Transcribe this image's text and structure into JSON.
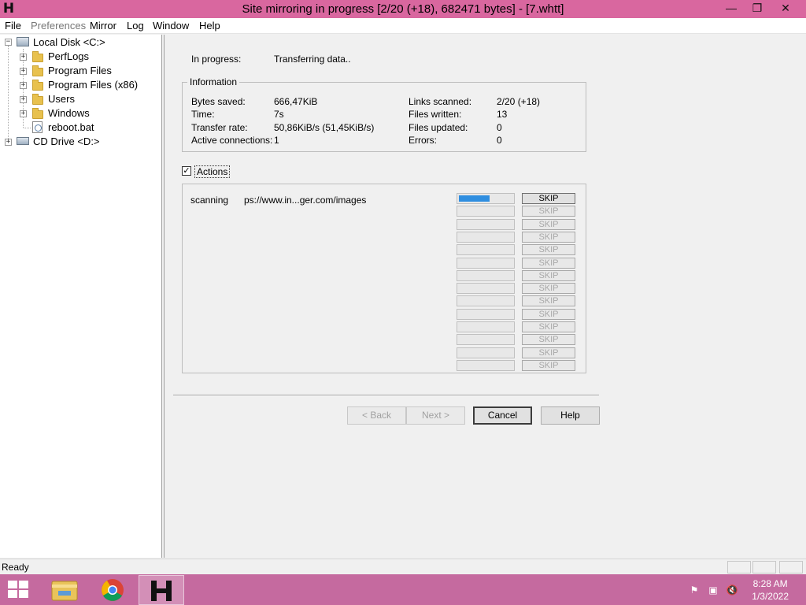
{
  "window": {
    "title": "Site mirroring in progress [2/20 (+18), 682471 bytes] - [7.whtt]",
    "app_icon_letter": "H",
    "controls": {
      "minimize": "—",
      "restore": "❐",
      "close": "✕"
    }
  },
  "menu": {
    "file": "File",
    "preferences": "Preferences",
    "mirror": "Mirror",
    "log": "Log",
    "window": "Window",
    "help": "Help"
  },
  "tree": {
    "expander_minus": "−",
    "expander_plus": "+",
    "local_disk": "Local Disk <C:>",
    "items": [
      "PerfLogs",
      "Program Files",
      "Program Files (x86)",
      "Users",
      "Windows",
      "reboot.bat"
    ],
    "cd_drive": "CD Drive <D:>"
  },
  "progress": {
    "in_progress_label": "In progress:",
    "in_progress_value": "Transferring data.."
  },
  "info": {
    "legend": "Information",
    "bytes_saved_label": "Bytes saved:",
    "bytes_saved_value": "666,47KiB",
    "time_label": "Time:",
    "time_value": "7s",
    "transfer_rate_label": "Transfer rate:",
    "transfer_rate_value": "50,86KiB/s (51,45KiB/s)",
    "active_connections_label": "Active connections:",
    "active_connections_value": "1",
    "links_scanned_label": "Links scanned:",
    "links_scanned_value": "2/20 (+18)",
    "files_written_label": "Files written:",
    "files_written_value": "13",
    "files_updated_label": "Files updated:",
    "files_updated_value": "0",
    "errors_label": "Errors:",
    "errors_value": "0"
  },
  "actions": {
    "checkbox_mark": "✓",
    "label": "Actions",
    "row_status": "scanning",
    "row_url": "ps://www.in...ger.com/images",
    "first_bar_progress": 0.58,
    "skip_label": "SKIP"
  },
  "buttons": {
    "back": "< Back",
    "next": "Next >",
    "cancel": "Cancel",
    "help": "Help"
  },
  "status": {
    "text": "Ready"
  },
  "taskbar": {
    "clock_time": "8:28 AM",
    "clock_date": "1/3/2022",
    "accent": "#c56a9f"
  }
}
